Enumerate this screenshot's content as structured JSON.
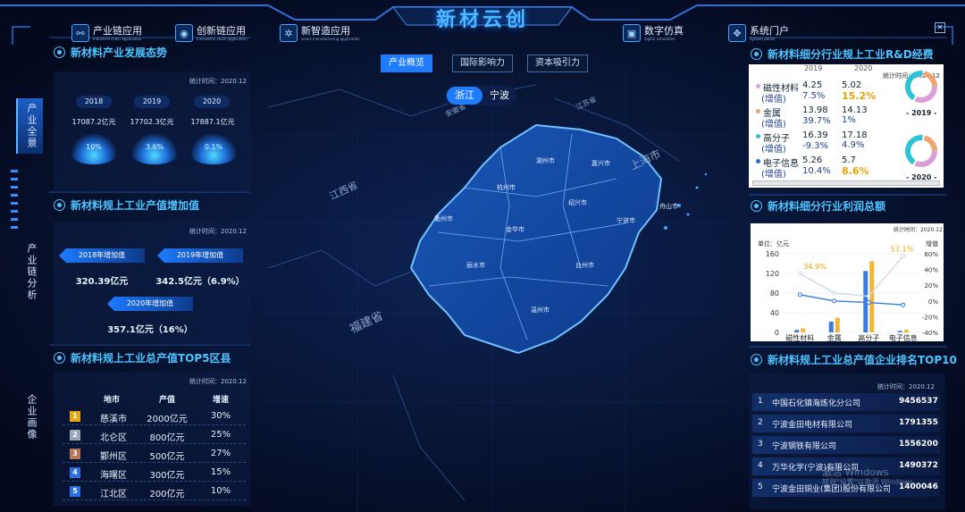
{
  "app": {
    "title": "新材云创"
  },
  "nav": [
    {
      "label": "产业链应用",
      "sub": "Industrial chain application",
      "icon": "chain-icon"
    },
    {
      "label": "创新链应用",
      "sub": "Innovation chain application",
      "icon": "bulb-icon"
    },
    {
      "label": "新智造应用",
      "sub": "smart manufacturing application",
      "icon": "gear-icon"
    },
    {
      "label": "数字仿真",
      "sub": "digital simulation",
      "icon": "monitor-icon"
    },
    {
      "label": "系统门户",
      "sub": "System portal",
      "icon": "grid-icon"
    }
  ],
  "close_label": "×",
  "side": [
    "产业全景",
    "产业链分析",
    "企业画像"
  ],
  "dev": {
    "title": "新材料产业发展态势",
    "stat": "统计时间：2020.12",
    "items": [
      {
        "year": "2018",
        "amount": "17087.2亿元",
        "pct": "10%"
      },
      {
        "year": "2019",
        "amount": "17702.3亿元",
        "pct": "3.6%"
      },
      {
        "year": "2020",
        "amount": "17887.1亿元",
        "pct": "0.1%"
      }
    ]
  },
  "addval": {
    "title": "新材料规上工业产值增加值",
    "stat": "统计时间：2020.12",
    "items": [
      {
        "label": "2018年增加值",
        "value": "320.39亿元"
      },
      {
        "label": "2019年增加值",
        "value": "342.5亿元（6.9%）"
      },
      {
        "label": "2020年增加值",
        "value": "357.1亿元（16%）"
      }
    ]
  },
  "top5": {
    "title": "新材料规上工业总产值TOP5区县",
    "stat": "统计时间：2020.12",
    "headers": [
      "地市",
      "产值",
      "增速"
    ],
    "rows": [
      {
        "rank": "1",
        "area": "慈溪市",
        "value": "2000亿元",
        "growth": "30%",
        "color": "#e6a817"
      },
      {
        "rank": "2",
        "area": "北仑区",
        "value": "800亿元",
        "growth": "25%",
        "color": "#9aa7b8"
      },
      {
        "rank": "3",
        "area": "鄞州区",
        "value": "500亿元",
        "growth": "27%",
        "color": "#b5785a"
      },
      {
        "rank": "4",
        "area": "海曙区",
        "value": "300亿元",
        "growth": "15%",
        "color": "#2c6fe0"
      },
      {
        "rank": "5",
        "area": "江北区",
        "value": "200亿元",
        "growth": "10%",
        "color": "#2c6fe0"
      }
    ]
  },
  "tabs": [
    "产业概览",
    "国际影响力",
    "资本吸引力"
  ],
  "province_tabs": [
    "浙江",
    "宁波"
  ],
  "map": {
    "provinces": [
      "安徽省",
      "江苏省",
      "上海市",
      "江西省",
      "福建省"
    ],
    "cities": [
      "湖州市",
      "嘉兴市",
      "杭州市",
      "绍兴市",
      "宁波市",
      "舟山市",
      "衢州市",
      "金华市",
      "台州市",
      "丽水市",
      "温州市"
    ]
  },
  "rd": {
    "title": "新材料细分行业规上工业R&D经费",
    "stat": "统计时间：2020.12",
    "year_headers": [
      "2019",
      "2020"
    ],
    "rows": [
      {
        "name": "磁性材料",
        "sub": "(增值)",
        "v2019": "4.25",
        "g2019": "7.5%",
        "v2020": "5.02",
        "g2020": "15.2%",
        "dot": "#d99ed8",
        "hl": true
      },
      {
        "name": "金属",
        "sub": "(增值)",
        "v2019": "13.98",
        "g2019": "39.7%",
        "v2020": "14.13",
        "g2020": "1%",
        "dot": "#f0a570",
        "hl": false
      },
      {
        "name": "高分子",
        "sub": "(增值)",
        "v2019": "16.39",
        "g2019": "-9.3%",
        "v2020": "17.18",
        "g2020": "4.9%",
        "dot": "#2bc3d6",
        "hl": false
      },
      {
        "name": "电子信息",
        "sub": "(增值)",
        "v2019": "5.26",
        "g2019": "10.4%",
        "v2020": "5.7",
        "g2020": "8.6%",
        "dot": "#1f6fe0",
        "hl": true
      }
    ],
    "donut_labels": [
      "- 2019 -",
      "- 2020 -"
    ]
  },
  "profit": {
    "title": "新材料细分行业利润总额",
    "stat": "统计时间：2020.12",
    "unit_left": "单位：亿元",
    "unit_right": "增值",
    "left_ticks": [
      "160",
      "120",
      "80",
      "40",
      "0"
    ],
    "right_ticks": [
      "60%",
      "40%",
      "20%",
      "0%",
      "-20%",
      "-40%"
    ],
    "peak_labels": [
      "34.9%",
      "57.1%"
    ]
  },
  "chart_data": {
    "type": "bar",
    "title": "新材料细分行业利润总额",
    "categories": [
      "磁性材料",
      "金属",
      "高分子",
      "电子信息"
    ],
    "series": [
      {
        "values": [
          5,
          22,
          125,
          3
        ],
        "color": "#3a7be0"
      },
      {
        "values": [
          8,
          30,
          145,
          5
        ],
        "color": "#f3b632"
      }
    ],
    "lines": [
      {
        "values": [
          34.9,
          10,
          6,
          57.1
        ],
        "color": "#cfd8e6"
      },
      {
        "values": [
          8,
          0,
          -2,
          -5
        ],
        "color": "#3a7be0"
      }
    ],
    "ylim": [
      0,
      160
    ],
    "y2lim": [
      -40,
      60
    ],
    "ylabel": "单位：亿元",
    "y2label": "增值"
  },
  "top10": {
    "title": "新材料规上工业总产值企业排名TOP10",
    "stat": "统计时间：2020.12",
    "rows": [
      {
        "rank": "1",
        "name": "中国石化镇海炼化分公司",
        "value": "9456537"
      },
      {
        "rank": "2",
        "name": "宁波金田电材有限公司",
        "value": "1791355"
      },
      {
        "rank": "3",
        "name": "宁波钢铁有限公司",
        "value": "1556200"
      },
      {
        "rank": "4",
        "name": "万华化学(宁波)有限公司",
        "value": "1490372"
      },
      {
        "rank": "5",
        "name": "宁波金田铜业(集团)股份有限公司",
        "value": "1400046"
      }
    ]
  },
  "watermark": [
    "激活 Windows",
    "转到\"设置\"以激活 Windows。"
  ]
}
